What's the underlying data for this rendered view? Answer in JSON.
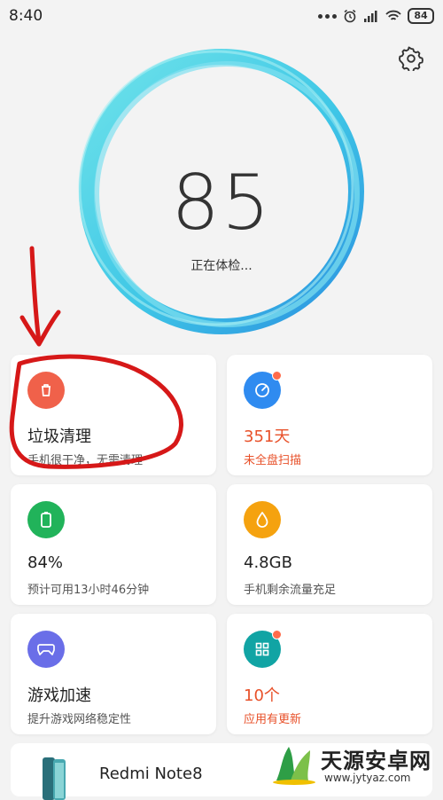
{
  "status_bar": {
    "time": "8:40",
    "battery": "84"
  },
  "scan": {
    "score": "85",
    "label": "正在体检..."
  },
  "cards": [
    {
      "id": "junk",
      "icon": "trash-icon",
      "color": "#f0614a",
      "title": "垃圾清理",
      "subtitle": "手机很干净，无需清理",
      "alert": false,
      "badge": false
    },
    {
      "id": "virus",
      "icon": "scan-gauge-icon",
      "color": "#2f8bf0",
      "title": "351天",
      "subtitle": "未全盘扫描",
      "alert": true,
      "badge": true
    },
    {
      "id": "battery",
      "icon": "battery-icon",
      "color": "#21b35a",
      "title": "84%",
      "subtitle": "预计可用13小时46分钟",
      "alert": false,
      "badge": false
    },
    {
      "id": "data",
      "icon": "water-drop-icon",
      "color": "#f5a20f",
      "title": "4.8GB",
      "subtitle": "手机剩余流量充足",
      "alert": false,
      "badge": false
    },
    {
      "id": "game",
      "icon": "gamepad-icon",
      "color": "#6a6ee8",
      "title": "游戏加速",
      "subtitle": "提升游戏网络稳定性",
      "alert": false,
      "badge": false
    },
    {
      "id": "apps",
      "icon": "apps-grid-icon",
      "color": "#11a4a4",
      "title": "10个",
      "subtitle": "应用有更新",
      "alert": true,
      "badge": true
    }
  ],
  "device": {
    "name": "Redmi Note8"
  },
  "watermark": {
    "title": "天源安卓网",
    "url": "www.jytyaz.com"
  },
  "colors": {
    "background": "#f3f3f3",
    "alert": "#e8512a",
    "annotation": "#d61818"
  }
}
